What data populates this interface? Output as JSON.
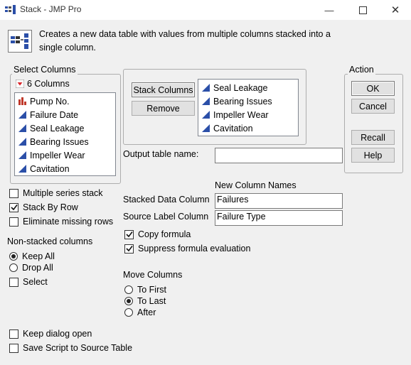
{
  "window": {
    "title": "Stack - JMP Pro"
  },
  "description": "Creates a new data table with values from multiple columns stacked into a single column.",
  "select_columns": {
    "label": "Select Columns",
    "count_label": "6 Columns",
    "items": [
      {
        "label": "Pump No.",
        "icon": "nominal-bar-icon"
      },
      {
        "label": "Failure Date",
        "icon": "continuous-icon"
      },
      {
        "label": "Seal Leakage",
        "icon": "continuous-icon"
      },
      {
        "label": "Bearing Issues",
        "icon": "continuous-icon"
      },
      {
        "label": "Impeller Wear",
        "icon": "continuous-icon"
      },
      {
        "label": "Cavitation",
        "icon": "continuous-icon"
      }
    ]
  },
  "stack": {
    "stack_columns_label": "Stack Columns",
    "remove_label": "Remove",
    "items": [
      "Seal Leakage",
      "Bearing Issues",
      "Impeller Wear",
      "Cavitation"
    ]
  },
  "output_table_label": "Output table name:",
  "output_table_value": "",
  "new_column_names": {
    "label": "New Column Names",
    "stacked_label": "Stacked Data Column",
    "stacked_value": "Failures",
    "source_label": "Source Label Column",
    "source_value": "Failure Type"
  },
  "options": {
    "multiple_series": {
      "label": "Multiple series stack",
      "checked": false
    },
    "stack_by_row": {
      "label": "Stack By Row",
      "checked": true
    },
    "eliminate_missing": {
      "label": "Eliminate missing rows",
      "checked": false
    },
    "copy_formula": {
      "label": "Copy formula",
      "checked": true
    },
    "suppress_formula": {
      "label": "Suppress formula evaluation",
      "checked": true
    },
    "select": {
      "label": "Select",
      "checked": false
    },
    "keep_dialog": {
      "label": "Keep dialog open",
      "checked": false
    },
    "save_script": {
      "label": "Save Script to Source Table",
      "checked": false
    }
  },
  "non_stacked": {
    "label": "Non-stacked columns",
    "keep_all": "Keep All",
    "drop_all": "Drop All",
    "selected": "Keep All"
  },
  "move_columns": {
    "label": "Move Columns",
    "to_first": "To First",
    "to_last": "To Last",
    "after": "After",
    "selected": "To Last"
  },
  "action": {
    "label": "Action",
    "ok": "OK",
    "cancel": "Cancel",
    "recall": "Recall",
    "help": "Help"
  },
  "colors": {
    "continuous_icon": "#2b4fa8",
    "nominal_icon": "#c0392b",
    "dropdown_icon": "#d9262b"
  }
}
